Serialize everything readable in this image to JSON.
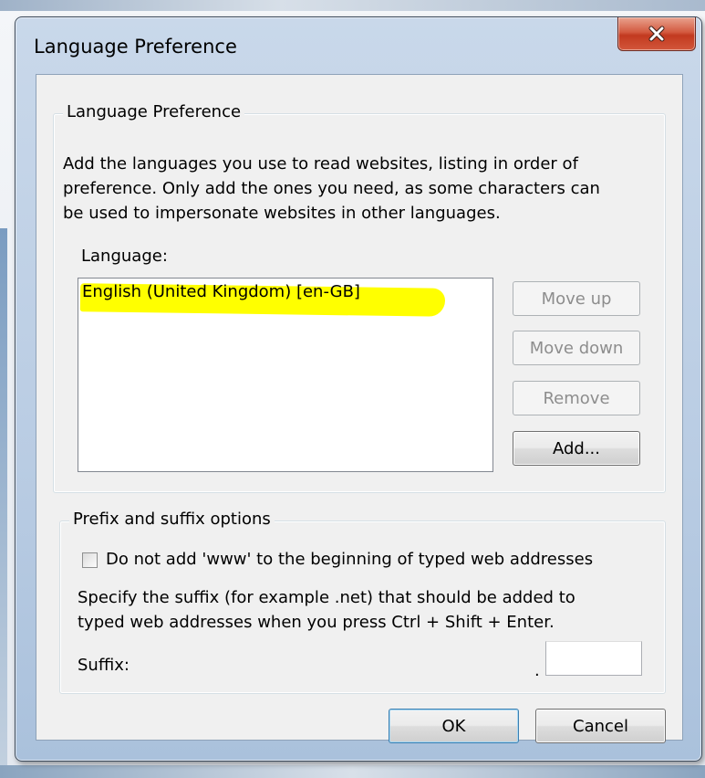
{
  "window": {
    "title": "Language Preference"
  },
  "language_group": {
    "legend": "Language Preference",
    "description_lines": [
      "Add the languages you use to read websites, listing in order of",
      "preference. Only add the ones you need, as some characters can",
      "be used to impersonate websites in other languages."
    ],
    "list_label": "Language:",
    "languages": [
      "English (United Kingdom) [en-GB]"
    ],
    "buttons": {
      "move_up": "Move up",
      "move_down": "Move down",
      "remove": "Remove",
      "add": "Add..."
    }
  },
  "prefix_group": {
    "legend": "Prefix and suffix options",
    "checkbox_label": "Do not add 'www' to the beginning of typed web addresses",
    "checkbox_checked": false,
    "suffix_description_lines": [
      "Specify the suffix (for example .net) that should be added to",
      "typed web addresses when you press Ctrl + Shift + Enter."
    ],
    "suffix_label": "Suffix:",
    "suffix_dot": ".",
    "suffix_value": ""
  },
  "footer": {
    "ok_label": "OK",
    "cancel_label": "Cancel"
  },
  "colors": {
    "highlight": "#ffff00",
    "close_button": "#c2391f"
  },
  "icons": {
    "close": "close-icon"
  }
}
